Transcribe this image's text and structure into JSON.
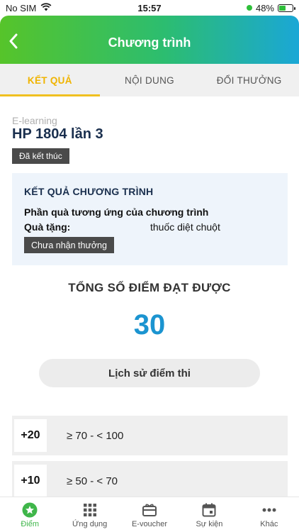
{
  "status_bar": {
    "carrier": "No SIM",
    "time": "15:57",
    "battery": "48%",
    "battery_level": 0.48
  },
  "header": {
    "title": "Chương trình"
  },
  "tabs": [
    {
      "label": "KẾT QUẢ",
      "active": true
    },
    {
      "label": "NỘI DUNG",
      "active": false
    },
    {
      "label": "ĐỔI THƯỞNG",
      "active": false
    }
  ],
  "program": {
    "category": "E-learning",
    "title": "HP 1804 lần 3",
    "status": "Đã kết thúc"
  },
  "result": {
    "section_title": "KẾT QUẢ CHƯƠNG TRÌNH",
    "reward_heading": "Phần quà tương ứng của chương trình",
    "gift_label": "Quà tặng:",
    "gift_value": "thuốc diệt chuột",
    "reward_status": "Chưa nhận thưởng"
  },
  "score": {
    "label": "TỔNG SỐ ĐIỂM ĐẠT ĐƯỢC",
    "value": "30"
  },
  "history_button": "Lịch sử điểm thi",
  "tiers": [
    {
      "points": "+20",
      "range": "≥ 70 - < 100"
    },
    {
      "points": "+10",
      "range": "≥ 50 - < 70"
    }
  ],
  "bottom_nav": [
    {
      "label": "Điểm",
      "icon": "star-icon",
      "active": true
    },
    {
      "label": "Ứng dụng",
      "icon": "grid-icon",
      "active": false
    },
    {
      "label": "E-voucher",
      "icon": "voucher-icon",
      "active": false
    },
    {
      "label": "Sự kiện",
      "icon": "calendar-icon",
      "active": false
    },
    {
      "label": "Khác",
      "icon": "more-icon",
      "active": false
    }
  ],
  "colors": {
    "accent_green": "#3fb64a",
    "tab_active": "#f0b400",
    "score_blue": "#1b94d0",
    "title_navy": "#1a2f4e"
  }
}
